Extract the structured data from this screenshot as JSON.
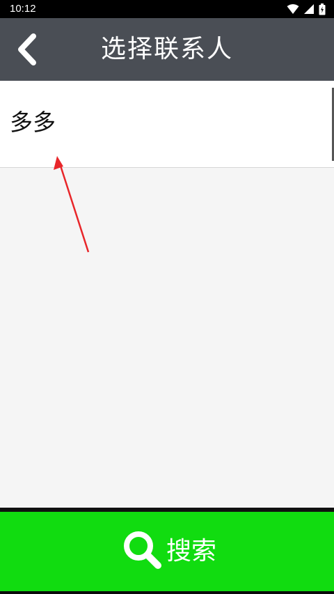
{
  "status_bar": {
    "time": "10:12",
    "icons": [
      "wifi-icon",
      "signal-icon",
      "battery-icon"
    ]
  },
  "header": {
    "title": "选择联系人",
    "back_icon": "chevron-left-icon",
    "background": "#4a4e55"
  },
  "contacts": [
    {
      "name": "多多"
    }
  ],
  "annotation": {
    "type": "red-arrow",
    "color": "#e8262a"
  },
  "footer": {
    "search_label": "搜索",
    "search_icon": "search-icon",
    "background": "#11dc10"
  }
}
